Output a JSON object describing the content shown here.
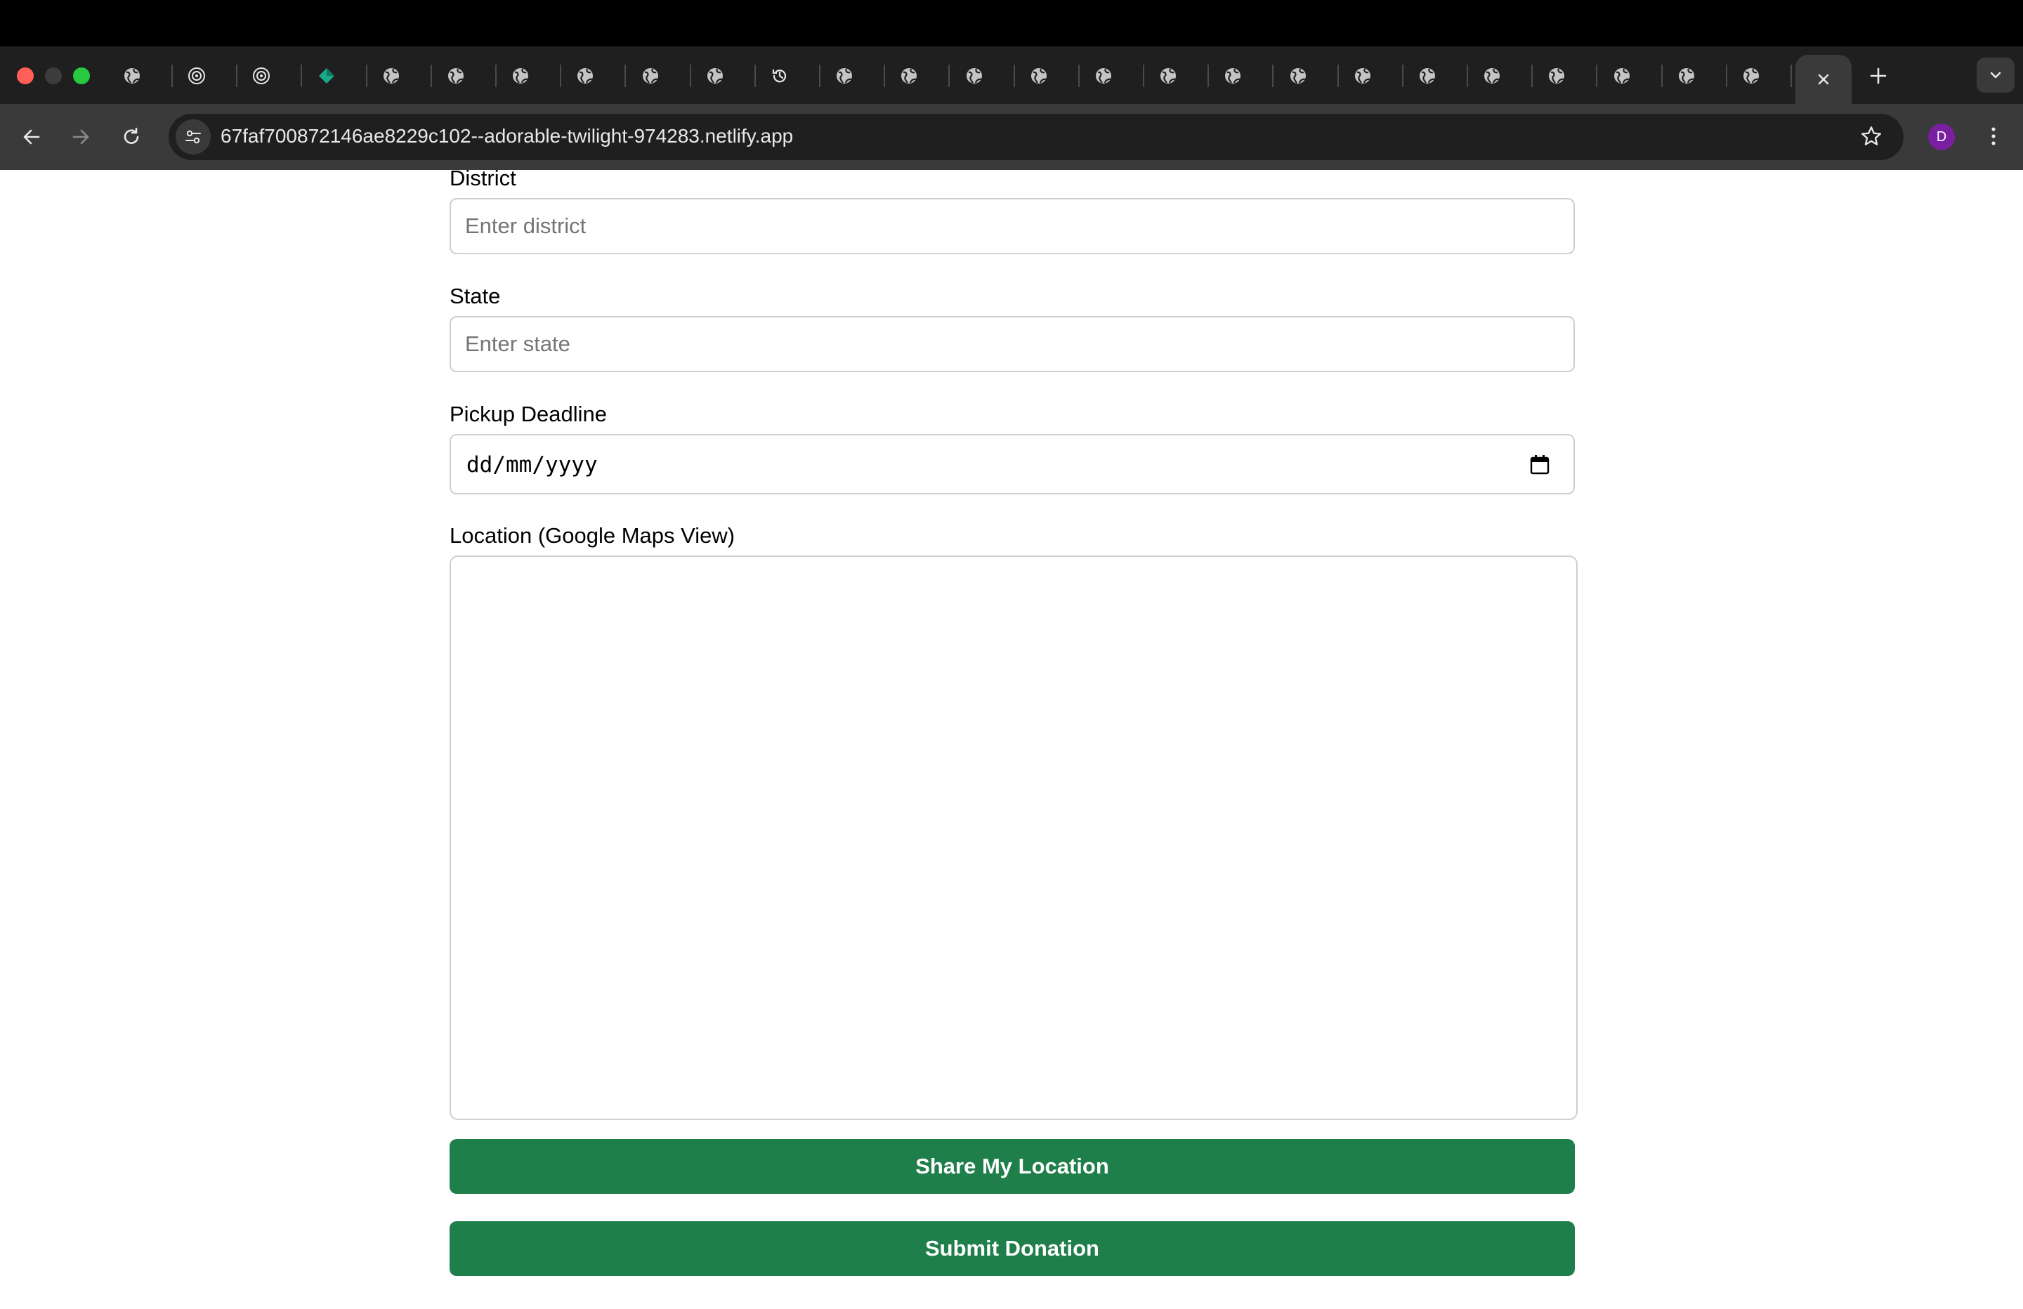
{
  "browser": {
    "url": "67faf700872146ae8229c102--adorable-twilight-974283.netlify.app",
    "profile_initial": "D",
    "accent_profile_color": "#7b1fa2",
    "tab_favicons": [
      "globe-icon",
      "openai-icon",
      "openai-icon",
      "gem-icon",
      "globe-icon",
      "globe-icon",
      "globe-icon",
      "globe-icon",
      "globe-icon",
      "globe-icon",
      "history-icon",
      "globe-icon",
      "globe-icon",
      "globe-icon",
      "globe-icon",
      "globe-icon",
      "globe-icon",
      "globe-icon",
      "globe-icon",
      "globe-icon",
      "globe-icon",
      "globe-icon",
      "globe-icon",
      "globe-icon",
      "globe-icon",
      "globe-icon"
    ]
  },
  "form": {
    "district": {
      "label": "District",
      "placeholder": "Enter district",
      "value": ""
    },
    "state": {
      "label": "State",
      "placeholder": "Enter state",
      "value": ""
    },
    "pickup_deadline": {
      "label": "Pickup Deadline",
      "display": "dd/mm/yyyy"
    },
    "location": {
      "label": "Location (Google Maps View)"
    },
    "share_location_label": "Share My Location",
    "submit_label": "Submit Donation",
    "button_color": "#1f7f4a"
  }
}
